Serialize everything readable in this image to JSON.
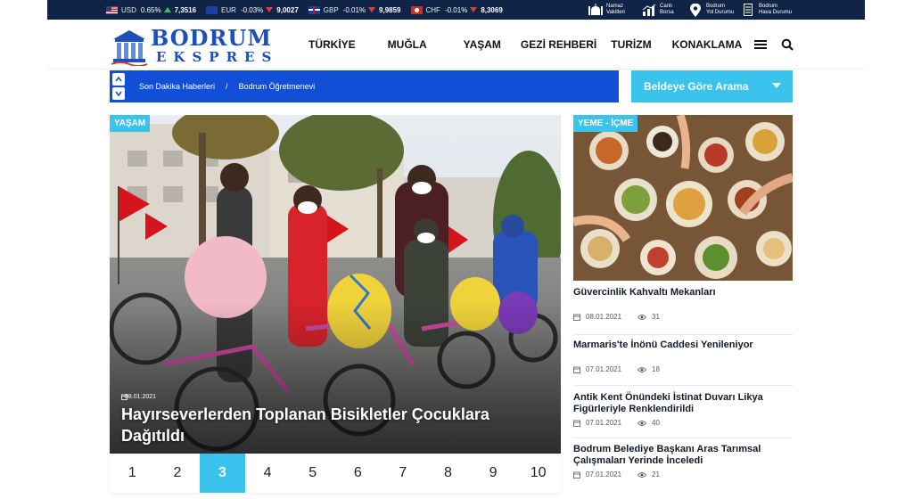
{
  "ticker": [
    {
      "flag": "us",
      "code": "USD",
      "pct": "0.65%",
      "dir": "up",
      "value": "7,3516"
    },
    {
      "flag": "eu",
      "code": "EUR",
      "pct": "-0.03%",
      "dir": "down",
      "value": "9,0027"
    },
    {
      "flag": "gb",
      "code": "GBP",
      "pct": "-0.01%",
      "dir": "down",
      "value": "9,9859"
    },
    {
      "flag": "ch",
      "code": "CHF",
      "pct": "-0.01%",
      "dir": "down",
      "value": "8,3069"
    }
  ],
  "utility": {
    "prayer": {
      "line1": "Namaz",
      "line2": "Vakitleri",
      "icon": "mosque-icon"
    },
    "market": {
      "line1": "Canlı",
      "line2": "Borsa",
      "icon": "chart-icon"
    },
    "traffic": {
      "line1": "Bodrum",
      "line2": "Yol Durumu",
      "icon": "location-pin-icon"
    },
    "weather": {
      "line1": "Bodrum",
      "line2": "Hava Durumu",
      "icon": "weather-icon"
    }
  },
  "logo": {
    "line1": "BODRUM",
    "line2": "EKSPRES"
  },
  "nav": [
    "TÜRKİYE",
    "MUĞLA",
    "YAŞAM",
    "GEZİ REHBERİ",
    "TURİZM",
    "KONAKLAMA"
  ],
  "breadcrumb": {
    "items": [
      "Son Dakika Haberleri",
      "Bodrum Öğretmenevi"
    ],
    "separator": "/"
  },
  "search": {
    "label": "Beldeye Göre Arama"
  },
  "hero": {
    "category": "YAŞAM",
    "date": "08.01.2021",
    "title": "Hayırseverlerden Toplanan Bisikletler Çocuklara Dağıtıldı"
  },
  "pagination": {
    "pages": [
      "1",
      "2",
      "3",
      "4",
      "5",
      "6",
      "7",
      "8",
      "9",
      "10"
    ],
    "active_index": 2
  },
  "side": {
    "category": "YEME - İÇME",
    "items": [
      {
        "title": "Güvercinlik Kahvaltı Mekanları",
        "date": "08.01.2021",
        "views": "31"
      },
      {
        "title": "Marmaris'te İnönü Caddesi Yenileniyor",
        "date": "07.01.2021",
        "views": "18"
      },
      {
        "title": "Antik Kent Önündeki İstinat Duvarı Likya Figürleriyle Renklendirildi",
        "date": "07.01.2021",
        "views": "40"
      },
      {
        "title": "Bodrum Belediye Başkanı Aras Tarımsal Çalışmaları Yerinde İnceledi",
        "date": "07.01.2021",
        "views": "21"
      }
    ]
  },
  "colors": {
    "navy": "#0f2446",
    "blue": "#1150d6",
    "accent": "#3ac3ec",
    "logo": "#1d4fb8"
  }
}
